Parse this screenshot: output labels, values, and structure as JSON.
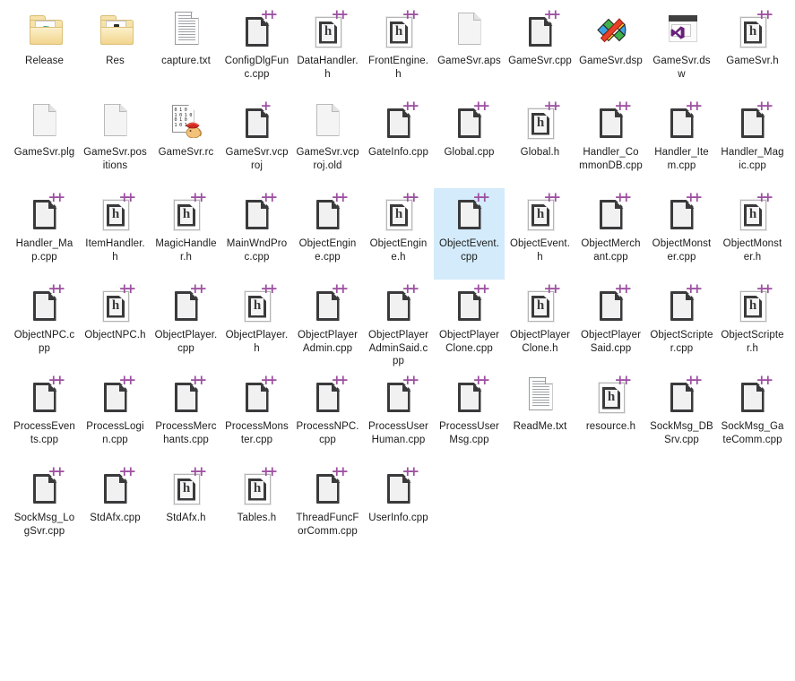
{
  "view": {
    "background": "#ffffff",
    "selection_color": "#d3ebfb",
    "text_color": "#1b1b1b",
    "columns": 11
  },
  "items": [
    {
      "name": "Release",
      "icon": "folder-release-icon",
      "type": "folder",
      "selected": false
    },
    {
      "name": "Res",
      "icon": "folder-res-icon",
      "type": "folder",
      "selected": false
    },
    {
      "name": "capture.txt",
      "icon": "text-document-icon",
      "type": "txt",
      "selected": false
    },
    {
      "name": "ConfigDlgFunc.cpp",
      "icon": "cpp-source-icon",
      "type": "cpp",
      "selected": false
    },
    {
      "name": "DataHandler.h",
      "icon": "cpp-header-icon",
      "type": "h",
      "selected": false
    },
    {
      "name": "FrontEngine.h",
      "icon": "cpp-header-icon",
      "type": "h",
      "selected": false
    },
    {
      "name": "GameSvr.aps",
      "icon": "blank-document-icon",
      "type": "blank",
      "selected": false
    },
    {
      "name": "GameSvr.cpp",
      "icon": "cpp-source-icon",
      "type": "cpp",
      "selected": false
    },
    {
      "name": "GameSvr.dsp",
      "icon": "vc6-project-icon",
      "type": "dsp",
      "selected": false
    },
    {
      "name": "GameSvr.dsw",
      "icon": "visual-studio-icon",
      "type": "dsw",
      "selected": false
    },
    {
      "name": "GameSvr.h",
      "icon": "cpp-header-icon",
      "type": "h",
      "selected": false
    },
    {
      "name": "GameSvr.plg",
      "icon": "blank-document-icon",
      "type": "blank",
      "selected": false
    },
    {
      "name": "GameSvr.positions",
      "icon": "blank-document-icon",
      "type": "blank",
      "selected": false
    },
    {
      "name": "GameSvr.rc",
      "icon": "resource-script-icon",
      "type": "rc",
      "selected": false
    },
    {
      "name": "GameSvr.vcproj",
      "icon": "vcproj-icon",
      "type": "vcproj",
      "selected": false
    },
    {
      "name": "GameSvr.vcproj.old",
      "icon": "blank-document-icon",
      "type": "blank",
      "selected": false
    },
    {
      "name": "GateInfo.cpp",
      "icon": "cpp-source-icon",
      "type": "cpp",
      "selected": false
    },
    {
      "name": "Global.cpp",
      "icon": "cpp-source-icon",
      "type": "cpp",
      "selected": false
    },
    {
      "name": "Global.h",
      "icon": "cpp-header-icon",
      "type": "h",
      "selected": false
    },
    {
      "name": "Handler_CommonDB.cpp",
      "icon": "cpp-source-icon",
      "type": "cpp",
      "selected": false
    },
    {
      "name": "Handler_Item.cpp",
      "icon": "cpp-source-icon",
      "type": "cpp",
      "selected": false
    },
    {
      "name": "Handler_Magic.cpp",
      "icon": "cpp-source-icon",
      "type": "cpp",
      "selected": false
    },
    {
      "name": "Handler_Map.cpp",
      "icon": "cpp-source-icon",
      "type": "cpp",
      "selected": false
    },
    {
      "name": "ItemHandler.h",
      "icon": "cpp-header-icon",
      "type": "h",
      "selected": false
    },
    {
      "name": "MagicHandler.h",
      "icon": "cpp-header-icon",
      "type": "h",
      "selected": false
    },
    {
      "name": "MainWndProc.cpp",
      "icon": "cpp-source-icon",
      "type": "cpp",
      "selected": false
    },
    {
      "name": "ObjectEngine.cpp",
      "icon": "cpp-source-icon",
      "type": "cpp",
      "selected": false
    },
    {
      "name": "ObjectEngine.h",
      "icon": "cpp-header-icon",
      "type": "h",
      "selected": false
    },
    {
      "name": "ObjectEvent.cpp",
      "icon": "cpp-source-icon",
      "type": "cpp",
      "selected": true
    },
    {
      "name": "ObjectEvent.h",
      "icon": "cpp-header-icon",
      "type": "h",
      "selected": false
    },
    {
      "name": "ObjectMerchant.cpp",
      "icon": "cpp-source-icon",
      "type": "cpp",
      "selected": false
    },
    {
      "name": "ObjectMonster.cpp",
      "icon": "cpp-source-icon",
      "type": "cpp",
      "selected": false
    },
    {
      "name": "ObjectMonster.h",
      "icon": "cpp-header-icon",
      "type": "h",
      "selected": false
    },
    {
      "name": "ObjectNPC.cpp",
      "icon": "cpp-source-icon",
      "type": "cpp",
      "selected": false
    },
    {
      "name": "ObjectNPC.h",
      "icon": "cpp-header-icon",
      "type": "h",
      "selected": false
    },
    {
      "name": "ObjectPlayer.cpp",
      "icon": "cpp-source-icon",
      "type": "cpp",
      "selected": false
    },
    {
      "name": "ObjectPlayer.h",
      "icon": "cpp-header-icon",
      "type": "h",
      "selected": false
    },
    {
      "name": "ObjectPlayerAdmin.cpp",
      "icon": "cpp-source-icon",
      "type": "cpp",
      "selected": false
    },
    {
      "name": "ObjectPlayerAdminSaid.cpp",
      "icon": "cpp-source-icon",
      "type": "cpp",
      "selected": false
    },
    {
      "name": "ObjectPlayerClone.cpp",
      "icon": "cpp-source-icon",
      "type": "cpp",
      "selected": false
    },
    {
      "name": "ObjectPlayerClone.h",
      "icon": "cpp-header-icon",
      "type": "h",
      "selected": false
    },
    {
      "name": "ObjectPlayerSaid.cpp",
      "icon": "cpp-source-icon",
      "type": "cpp",
      "selected": false
    },
    {
      "name": "ObjectScripter.cpp",
      "icon": "cpp-source-icon",
      "type": "cpp",
      "selected": false
    },
    {
      "name": "ObjectScripter.h",
      "icon": "cpp-header-icon",
      "type": "h",
      "selected": false
    },
    {
      "name": "ProcessEvents.cpp",
      "icon": "cpp-source-icon",
      "type": "cpp",
      "selected": false
    },
    {
      "name": "ProcessLogin.cpp",
      "icon": "cpp-source-icon",
      "type": "cpp",
      "selected": false
    },
    {
      "name": "ProcessMerchants.cpp",
      "icon": "cpp-source-icon",
      "type": "cpp",
      "selected": false
    },
    {
      "name": "ProcessMonster.cpp",
      "icon": "cpp-source-icon",
      "type": "cpp",
      "selected": false
    },
    {
      "name": "ProcessNPC.cpp",
      "icon": "cpp-source-icon",
      "type": "cpp",
      "selected": false
    },
    {
      "name": "ProcessUserHuman.cpp",
      "icon": "cpp-source-icon",
      "type": "cpp",
      "selected": false
    },
    {
      "name": "ProcessUserMsg.cpp",
      "icon": "cpp-source-icon",
      "type": "cpp",
      "selected": false
    },
    {
      "name": "ReadMe.txt",
      "icon": "text-document-icon",
      "type": "txt",
      "selected": false
    },
    {
      "name": "resource.h",
      "icon": "cpp-header-icon",
      "type": "h",
      "selected": false
    },
    {
      "name": "SockMsg_DBSrv.cpp",
      "icon": "cpp-source-icon",
      "type": "cpp",
      "selected": false
    },
    {
      "name": "SockMsg_GateComm.cpp",
      "icon": "cpp-source-icon",
      "type": "cpp",
      "selected": false
    },
    {
      "name": "SockMsg_LogSvr.cpp",
      "icon": "cpp-source-icon",
      "type": "cpp",
      "selected": false
    },
    {
      "name": "StdAfx.cpp",
      "icon": "cpp-source-icon",
      "type": "cpp",
      "selected": false
    },
    {
      "name": "StdAfx.h",
      "icon": "cpp-header-icon",
      "type": "h",
      "selected": false
    },
    {
      "name": "Tables.h",
      "icon": "cpp-header-icon",
      "type": "h",
      "selected": false
    },
    {
      "name": "ThreadFuncForComm.cpp",
      "icon": "cpp-source-icon",
      "type": "cpp",
      "selected": false
    },
    {
      "name": "UserInfo.cpp",
      "icon": "cpp-source-icon",
      "type": "cpp",
      "selected": false
    }
  ]
}
